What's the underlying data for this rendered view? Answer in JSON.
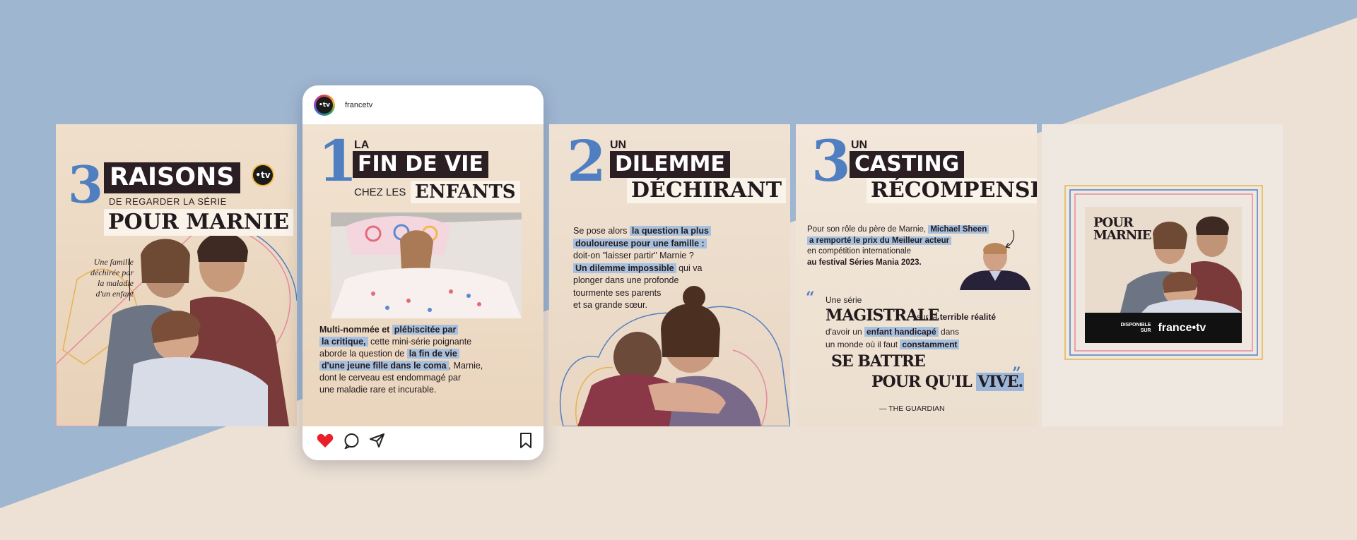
{
  "brand": {
    "handle": "francetv",
    "logo_text": "•tv"
  },
  "colors": {
    "accent_blue": "#4f7fc0",
    "highlight": "#9cb7d8",
    "dark": "#2b1f24",
    "background_blue": "#9fb6d1",
    "background_cream": "#ece1d4"
  },
  "panel1": {
    "number": "3",
    "title": "RAISONS",
    "sub": "DE REGARDER LA SÉRIE",
    "show": "POUR MARNIE",
    "caption_lines": [
      "Une famille",
      "déchirée par",
      "la maladie",
      "d'un enfant"
    ]
  },
  "panel2": {
    "number": "1",
    "word1": "LA",
    "title": "FIN DE VIE",
    "word2": "CHEZ LES",
    "title2": "ENFANTS",
    "body": [
      {
        "segments": [
          {
            "t": "Multi-nommée et ",
            "s": "b"
          },
          {
            "t": "plébiscitée par",
            "s": "m"
          }
        ]
      },
      {
        "segments": [
          {
            "t": "la critique,",
            "s": "m"
          },
          {
            "t": " cette mini-série poignante",
            "s": ""
          }
        ]
      },
      {
        "segments": [
          {
            "t": "aborde la question de ",
            "s": ""
          },
          {
            "t": "la fin de vie",
            "s": "m"
          }
        ]
      },
      {
        "segments": [
          {
            "t": "d'une jeune fille dans le coma",
            "s": "m"
          },
          {
            "t": ", Marnie,",
            "s": ""
          }
        ]
      },
      {
        "segments": [
          {
            "t": "dont le cerveau est endommagé par",
            "s": ""
          }
        ]
      },
      {
        "segments": [
          {
            "t": "une maladie rare et incurable.",
            "s": ""
          }
        ]
      }
    ]
  },
  "panel3": {
    "number": "2",
    "word1": "UN",
    "title": "DILEMME",
    "title2": "DÉCHIRANT",
    "body": [
      {
        "segments": [
          {
            "t": "Se pose alors ",
            "s": ""
          },
          {
            "t": "la question la plus",
            "s": "m"
          }
        ]
      },
      {
        "segments": [
          {
            "t": "douloureuse pour une famille :",
            "s": "m"
          }
        ]
      },
      {
        "segments": [
          {
            "t": "doit-on \"laisser partir\" Marnie ?",
            "s": ""
          }
        ]
      },
      {
        "segments": [
          {
            "t": "Un dilemme impossible",
            "s": "m"
          },
          {
            "t": "  qui va",
            "s": ""
          }
        ]
      },
      {
        "segments": [
          {
            "t": "plonger dans une profonde",
            "s": ""
          }
        ]
      },
      {
        "segments": [
          {
            "t": "tourmente ses parents",
            "s": ""
          }
        ]
      },
      {
        "segments": [
          {
            "t": "et sa grande sœur.",
            "s": ""
          }
        ]
      }
    ]
  },
  "panel4": {
    "number": "3",
    "word1": "UN",
    "title": "CASTING",
    "title2": "RÉCOMPENSÉ",
    "body": [
      {
        "segments": [
          {
            "t": "Pour son rôle du père de Marnie, ",
            "s": ""
          },
          {
            "t": "Michael Sheen",
            "s": "m"
          }
        ]
      },
      {
        "segments": [
          {
            "t": "a remporté le prix du Meilleur acteur",
            "s": "m"
          }
        ]
      },
      {
        "segments": [
          {
            "t": "en compétition internationale",
            "s": ""
          }
        ]
      },
      {
        "segments": [
          {
            "t": "au festival Séries Mania 2023.",
            "s": "b"
          }
        ]
      }
    ],
    "quote": {
      "line1": "Une série",
      "big1": "MAGISTRALE",
      "line2a": "sur la ",
      "line2b": "terrible réalité",
      "line3a": "d'avoir un ",
      "line3b": "enfant handicapé",
      "line3c": " dans",
      "line4a": "un monde où il faut ",
      "line4b": "constamment",
      "big2": "SE BATTRE",
      "big3a": "POUR QU'IL ",
      "big3b": "VIVE.",
      "source": "— THE GUARDIAN"
    }
  },
  "panel5": {
    "poster_title": "POUR\nMARNIE",
    "available": "DISPONIBLE\nSUR",
    "platform": "france•tv"
  }
}
